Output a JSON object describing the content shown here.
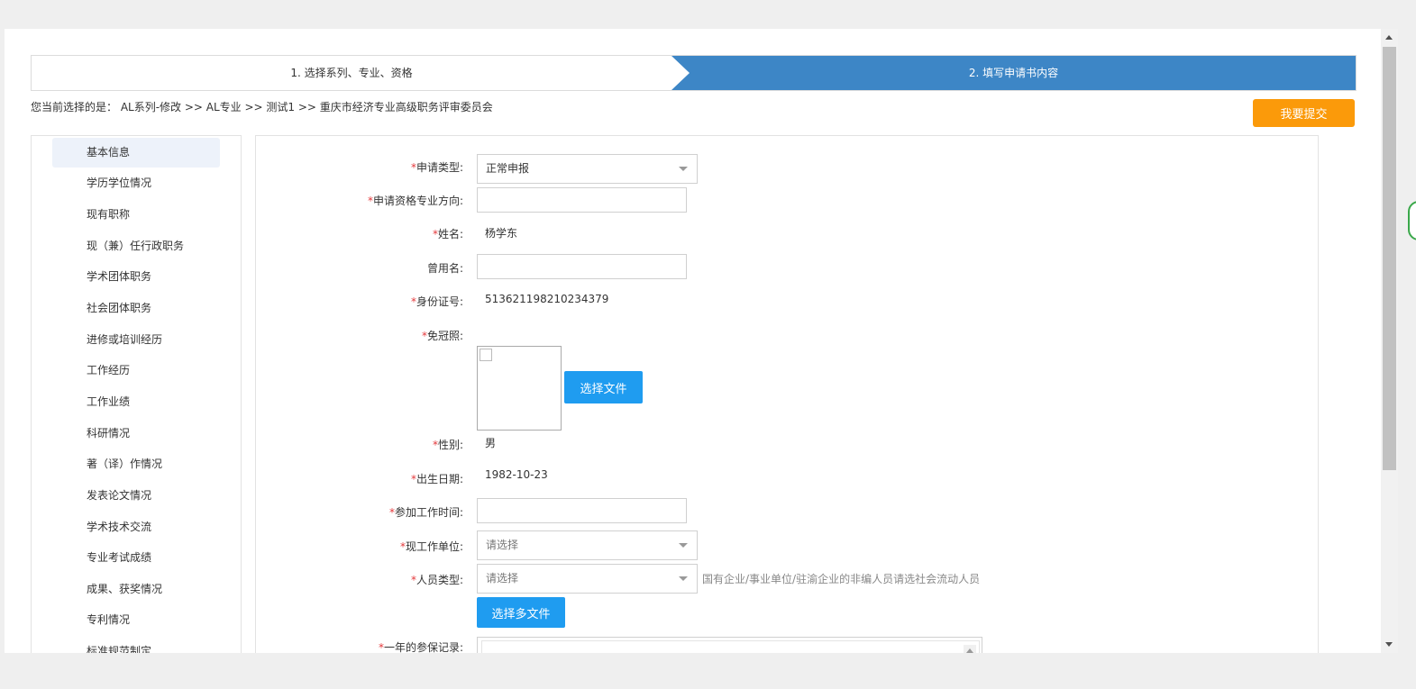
{
  "steps": {
    "step1": "1. 选择系列、专业、资格",
    "step2": "2. 填写申请书内容"
  },
  "crumb": "您当前选择的是： AL系列-修改 >> AL专业 >> 测试1 >> 重庆市经济专业高级职务评审委员会",
  "submit_label": "我要提交",
  "nav": {
    "items": [
      "基本信息",
      "学历学位情况",
      "现有职称",
      "现（兼）任行政职务",
      "学术团体职务",
      "社会团体职务",
      "进修或培训经历",
      "工作经历",
      "工作业绩",
      "科研情况",
      "著（译）作情况",
      "发表论文情况",
      "学术技术交流",
      "专业考试成绩",
      "成果、获奖情况",
      "专利情况",
      "标准规范制定"
    ]
  },
  "form": {
    "required_mark": "*",
    "apply_type": {
      "label": "申请类型:",
      "value": "正常申报"
    },
    "major_direction": {
      "label": "申请资格专业方向:",
      "value": ""
    },
    "name": {
      "label": "姓名:",
      "value": "杨学东"
    },
    "former_name": {
      "label": "曾用名:",
      "value": ""
    },
    "id_number": {
      "label": "身份证号:",
      "value": "513621198210234379"
    },
    "photo": {
      "label": "免冠照:",
      "button": "选择文件"
    },
    "gender": {
      "label": "性别:",
      "value": "男"
    },
    "birth_date": {
      "label": "出生日期:",
      "value": "1982-10-23"
    },
    "work_start": {
      "label": "参加工作时间:",
      "value": ""
    },
    "employer": {
      "label": "现工作单位:",
      "placeholder": "请选择"
    },
    "person_type": {
      "label": "人员类型:",
      "placeholder": "请选择",
      "hint": "国有企业/事业单位/驻渝企业的非编人员请选社会流动人员"
    },
    "multi_file_button": "选择多文件",
    "insurance": {
      "label": "一年的参保记录:"
    }
  }
}
